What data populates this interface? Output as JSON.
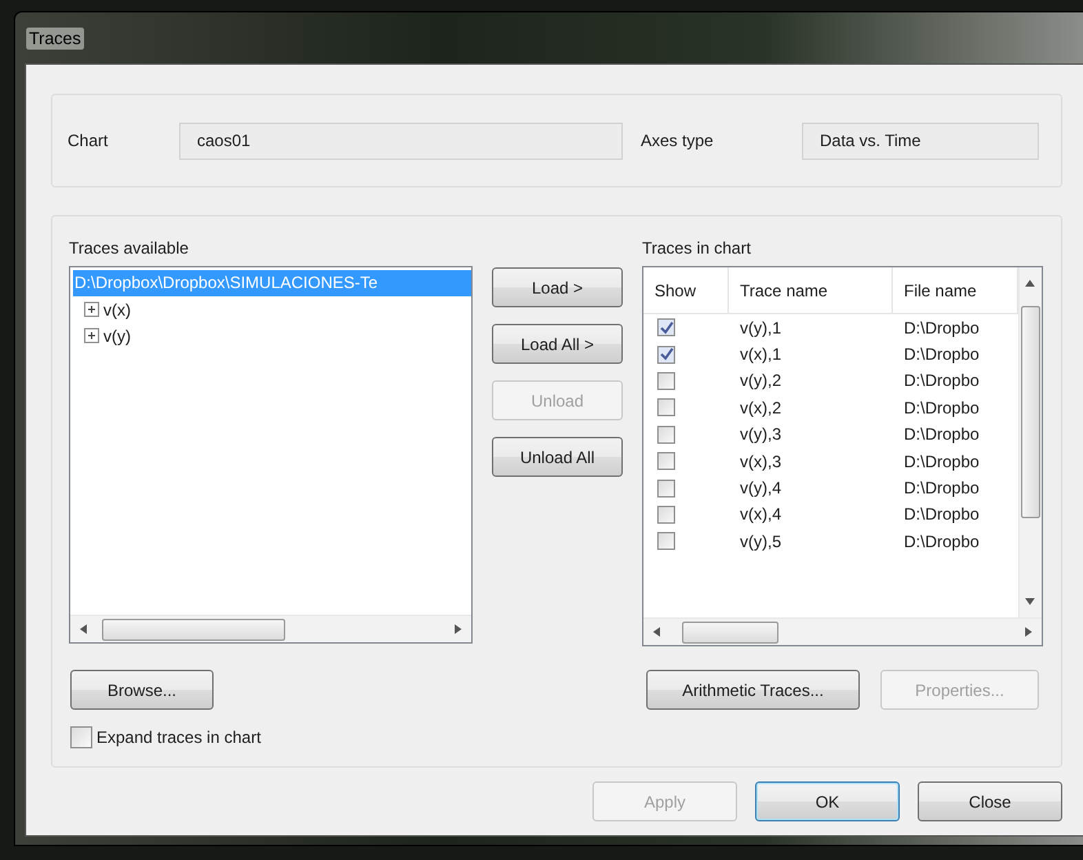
{
  "window": {
    "title": "Traces"
  },
  "chart_field": {
    "label": "Chart",
    "value": "caos01"
  },
  "axes_field": {
    "label": "Axes type",
    "value": "Data vs. Time"
  },
  "traces_available": {
    "label": "Traces available",
    "root": {
      "label": "D:\\Dropbox\\Dropbox\\SIMULACIONES-Te",
      "selected": true,
      "children": [
        {
          "label": "v(x)",
          "expanded": false
        },
        {
          "label": "v(y)",
          "expanded": false
        }
      ]
    }
  },
  "middle_buttons": [
    {
      "label": "Load >",
      "disabled": false
    },
    {
      "label": "Load All >",
      "disabled": false
    },
    {
      "label": "Unload",
      "disabled": true
    },
    {
      "label": "Unload All",
      "disabled": false
    }
  ],
  "traces_in_chart": {
    "label": "Traces in chart",
    "columns": [
      "Show",
      "Trace name",
      "File name"
    ],
    "rows": [
      {
        "show": true,
        "trace": "v(y),1",
        "file": "D:\\Dropbo"
      },
      {
        "show": true,
        "trace": "v(x),1",
        "file": "D:\\Dropbo"
      },
      {
        "show": false,
        "trace": "v(y),2",
        "file": "D:\\Dropbo"
      },
      {
        "show": false,
        "trace": "v(x),2",
        "file": "D:\\Dropbo"
      },
      {
        "show": false,
        "trace": "v(y),3",
        "file": "D:\\Dropbo"
      },
      {
        "show": false,
        "trace": "v(x),3",
        "file": "D:\\Dropbo"
      },
      {
        "show": false,
        "trace": "v(y),4",
        "file": "D:\\Dropbo"
      },
      {
        "show": false,
        "trace": "v(x),4",
        "file": "D:\\Dropbo"
      },
      {
        "show": false,
        "trace": "v(y),5",
        "file": "D:\\Dropbo"
      }
    ]
  },
  "browse_button": {
    "label": "Browse...",
    "disabled": false
  },
  "arithmetic_button": {
    "label": "Arithmetic Traces...",
    "disabled": false
  },
  "properties_button": {
    "label": "Properties...",
    "disabled": true
  },
  "expand_checkbox": {
    "label": "Expand traces in chart",
    "checked": false
  },
  "footer_buttons": [
    {
      "label": "Apply",
      "disabled": true,
      "default": false
    },
    {
      "label": "OK",
      "disabled": false,
      "default": true
    },
    {
      "label": "Close",
      "disabled": false,
      "default": false
    }
  ]
}
